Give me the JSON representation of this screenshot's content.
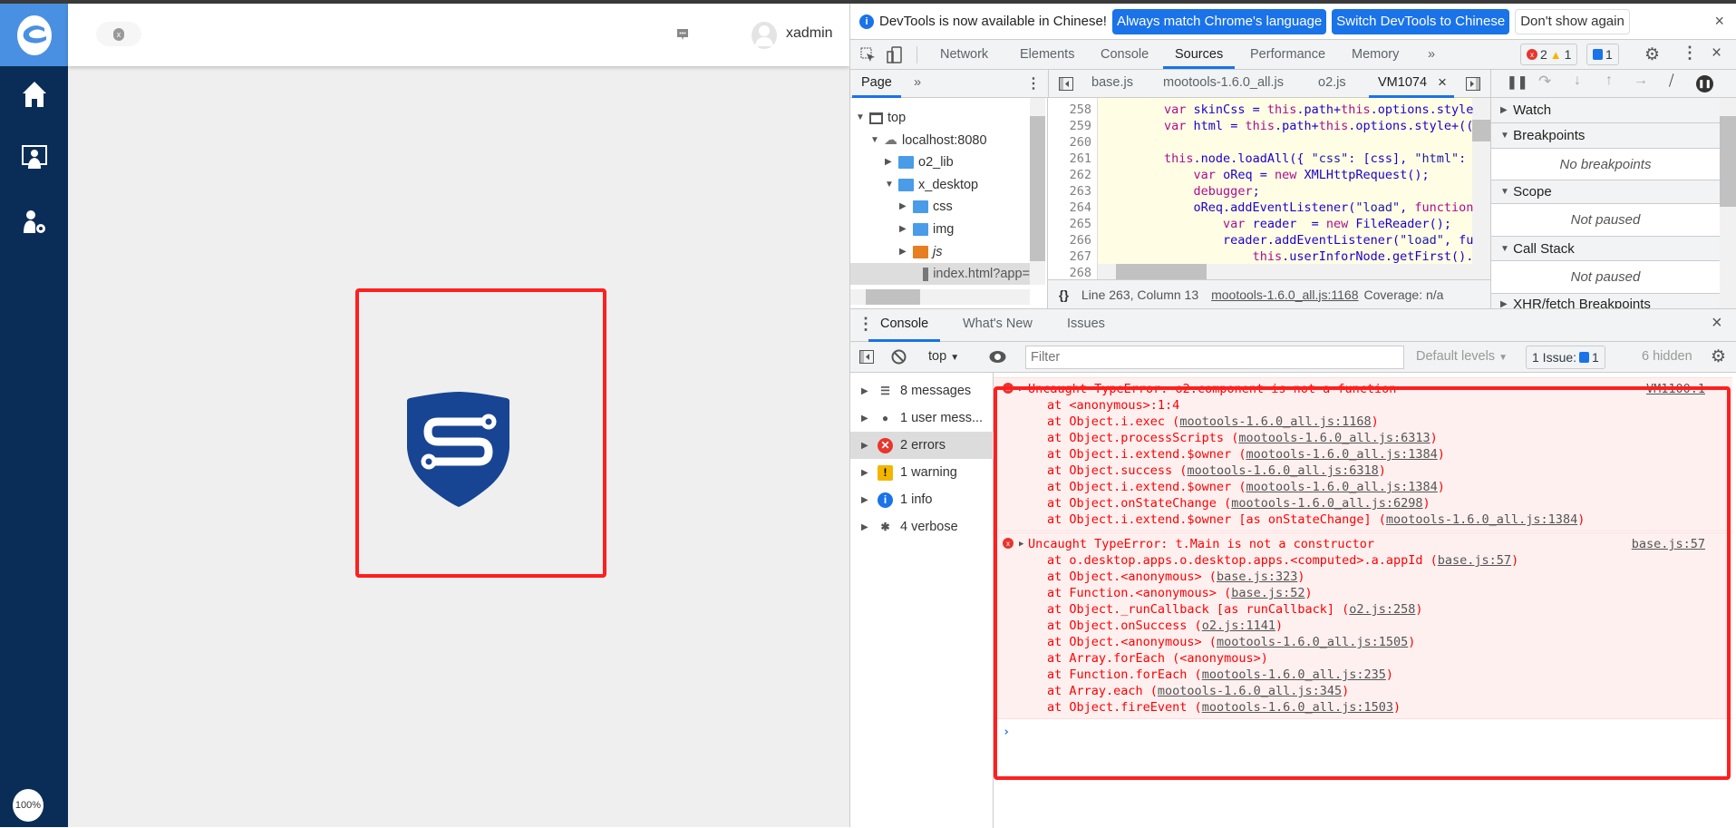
{
  "app": {
    "user_name": "xadmin",
    "zoom_level": "100%",
    "nav_icons": [
      "home-icon",
      "desktop-user-icon",
      "user-settings-icon"
    ]
  },
  "devtools": {
    "banner": {
      "message": "DevTools is now available in Chinese!",
      "btn_match": "Always match Chrome's language",
      "btn_switch": "Switch DevTools to Chinese",
      "btn_dismiss": "Don't show again"
    },
    "tabs": [
      "Network",
      "Elements",
      "Console",
      "Sources",
      "Performance",
      "Memory"
    ],
    "active_tab": "Sources",
    "more": "»",
    "error_count": "2",
    "warning_count": "1",
    "issue_count": "1",
    "navigator": {
      "tab": "Page",
      "more": "»",
      "tree": [
        {
          "label": "top",
          "level": 0,
          "arrow": "▼",
          "icon": "frame"
        },
        {
          "label": "localhost:8080",
          "level": 1,
          "arrow": "▼",
          "icon": "cloud"
        },
        {
          "label": "o2_lib",
          "level": 2,
          "arrow": "▶",
          "icon": "folder-blue"
        },
        {
          "label": "x_desktop",
          "level": 2,
          "arrow": "▼",
          "icon": "folder-blue"
        },
        {
          "label": "css",
          "level": 3,
          "arrow": "▶",
          "icon": "folder-blue"
        },
        {
          "label": "img",
          "level": 3,
          "arrow": "▶",
          "icon": "folder-blue"
        },
        {
          "label": "js",
          "level": 3,
          "arrow": "▶",
          "icon": "folder-orange"
        },
        {
          "label": "index.html?app=",
          "level": 4,
          "arrow": "",
          "icon": "file",
          "selected": true
        }
      ]
    },
    "editor_tabs": [
      "base.js",
      "mootools-1.6.0_all.js",
      "o2.js",
      "VM1074"
    ],
    "active_editor_tab": "VM1074",
    "code": [
      {
        "n": "258",
        "t": "        var skinCss = this.path+this.options.style"
      },
      {
        "n": "259",
        "t": "        var html = this.path+this.options.style+(("
      },
      {
        "n": "260",
        "t": ""
      },
      {
        "n": "261",
        "t": "        this.node.loadAll({ \"css\": [css], \"html\": "
      },
      {
        "n": "262",
        "t": "            var oReq = new XMLHttpRequest();"
      },
      {
        "n": "263",
        "t": "            debugger;"
      },
      {
        "n": "264",
        "t": "            oReq.addEventListener(\"load\", function"
      },
      {
        "n": "265",
        "t": "                var reader  = new FileReader();"
      },
      {
        "n": "266",
        "t": "                reader.addEventListener(\"load\", fu"
      },
      {
        "n": "267",
        "t": "                    this.userInforNode.getFirst()."
      },
      {
        "n": "268",
        "t": ""
      }
    ],
    "status": {
      "position": "Line 263, Column 13",
      "source_link": "mootools-1.6.0_all.js:1168",
      "coverage": "Coverage: n/a"
    },
    "debugger_sidebar": {
      "watch": "Watch",
      "breakpoints": "Breakpoints",
      "no_breakpoints": "No breakpoints",
      "scope": "Scope",
      "scope_body": "Not paused",
      "call_stack": "Call Stack",
      "call_stack_body": "Not paused",
      "xhr": "XHR/fetch Breakpoints"
    },
    "drawer": {
      "tabs": [
        "Console",
        "What's New",
        "Issues"
      ],
      "context": "top",
      "filter_placeholder": "Filter",
      "levels": "Default levels",
      "issues_label": "1 Issue:",
      "issues_count": "1",
      "hidden": "6 hidden",
      "sidebar": [
        {
          "label": "8 messages",
          "icon": "list"
        },
        {
          "label": "1 user mess...",
          "icon": "user"
        },
        {
          "label": "2 errors",
          "icon": "error",
          "selected": true
        },
        {
          "label": "1 warning",
          "icon": "warning"
        },
        {
          "label": "1 info",
          "icon": "info"
        },
        {
          "label": "4 verbose",
          "icon": "bug"
        }
      ],
      "errors": [
        {
          "message": "Uncaught TypeError: o2.component is not a function",
          "source": "VM1100:1",
          "stack": [
            {
              "t": "at <anonymous>:1:4",
              "l": ""
            },
            {
              "t": "at Object.i.exec (",
              "l": "mootools-1.6.0_all.js:1168"
            },
            {
              "t": "at Object.processScripts (",
              "l": "mootools-1.6.0_all.js:6313"
            },
            {
              "t": "at Object.i.extend.$owner (",
              "l": "mootools-1.6.0_all.js:1384"
            },
            {
              "t": "at Object.success (",
              "l": "mootools-1.6.0_all.js:6318"
            },
            {
              "t": "at Object.i.extend.$owner (",
              "l": "mootools-1.6.0_all.js:1384"
            },
            {
              "t": "at Object.onStateChange (",
              "l": "mootools-1.6.0_all.js:6298"
            },
            {
              "t": "at Object.i.extend.$owner [as onStateChange] (",
              "l": "mootools-1.6.0_all.js:1384"
            }
          ]
        },
        {
          "message": "Uncaught TypeError: t.Main is not a constructor",
          "source": "base.js:57",
          "stack": [
            {
              "t": "at o.desktop.apps.o.desktop.apps.<computed>.a.appId (",
              "l": "base.js:57"
            },
            {
              "t": "at Object.<anonymous> (",
              "l": "base.js:323"
            },
            {
              "t": "at Function.<anonymous> (",
              "l": "base.js:52"
            },
            {
              "t": "at Object._runCallback [as runCallback] (",
              "l": "o2.js:258"
            },
            {
              "t": "at Object.onSuccess (",
              "l": "o2.js:1141"
            },
            {
              "t": "at Object.<anonymous> (",
              "l": "mootools-1.6.0_all.js:1505"
            },
            {
              "t": "at Array.forEach (<anonymous>)",
              "l": ""
            },
            {
              "t": "at Function.forEach (",
              "l": "mootools-1.6.0_all.js:235"
            },
            {
              "t": "at Array.each (",
              "l": "mootools-1.6.0_all.js:345"
            },
            {
              "t": "at Object.fireEvent (",
              "l": "mootools-1.6.0_all.js:1503"
            }
          ]
        }
      ],
      "prompt": "›"
    }
  },
  "colors": {
    "sidebar": "#0a2d57",
    "logo_bg": "#4a90e2",
    "shield": "#184494",
    "highlight_box": "#ff1f1f",
    "accent": "#1a73e8"
  }
}
